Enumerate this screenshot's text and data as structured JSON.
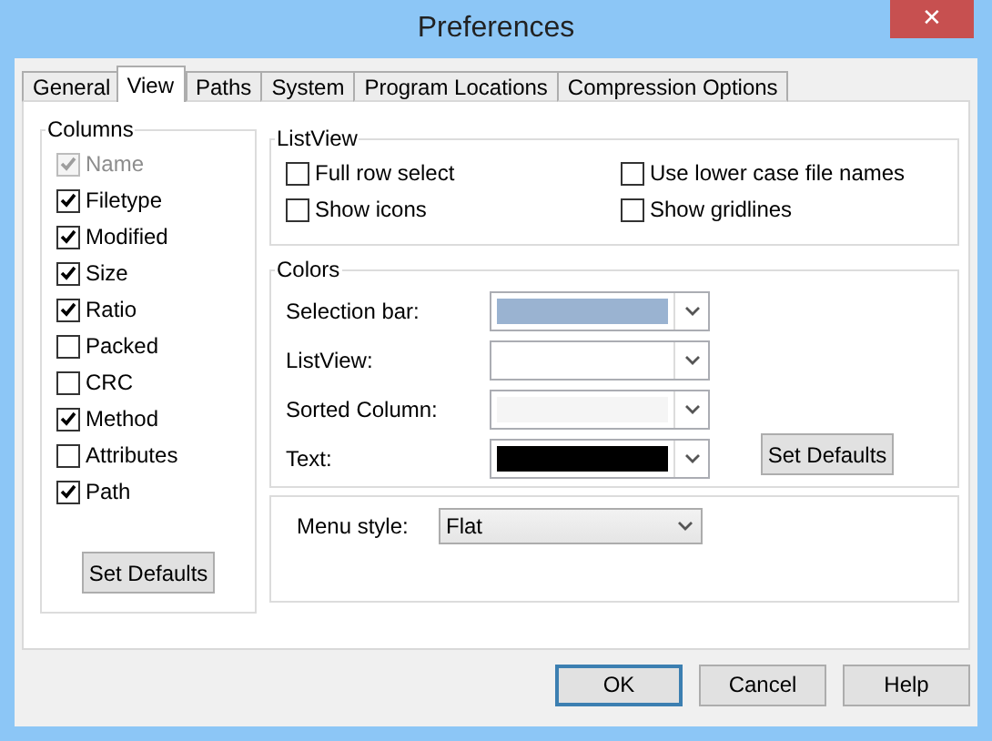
{
  "window": {
    "title": "Preferences",
    "close": "✕"
  },
  "tabs": [
    {
      "label": "General",
      "selected": false
    },
    {
      "label": "View",
      "selected": true
    },
    {
      "label": "Paths",
      "selected": false
    },
    {
      "label": "System",
      "selected": false
    },
    {
      "label": "Program Locations",
      "selected": false
    },
    {
      "label": "Compression Options",
      "selected": false
    }
  ],
  "columns": {
    "title": "Columns",
    "items": [
      {
        "label": "Name",
        "checked": true,
        "disabled": true
      },
      {
        "label": "Filetype",
        "checked": true,
        "disabled": false
      },
      {
        "label": "Modified",
        "checked": true,
        "disabled": false
      },
      {
        "label": "Size",
        "checked": true,
        "disabled": false
      },
      {
        "label": "Ratio",
        "checked": true,
        "disabled": false
      },
      {
        "label": "Packed",
        "checked": false,
        "disabled": false
      },
      {
        "label": "CRC",
        "checked": false,
        "disabled": false
      },
      {
        "label": "Method",
        "checked": true,
        "disabled": false
      },
      {
        "label": "Attributes",
        "checked": false,
        "disabled": false
      },
      {
        "label": "Path",
        "checked": true,
        "disabled": false
      }
    ],
    "button": "Set Defaults"
  },
  "listview": {
    "title": "ListView",
    "options": [
      {
        "label": "Full row select",
        "checked": false
      },
      {
        "label": "Use lower case file names",
        "checked": false
      },
      {
        "label": "Show icons",
        "checked": false
      },
      {
        "label": "Show gridlines",
        "checked": false
      }
    ]
  },
  "colors": {
    "title": "Colors",
    "rows": [
      {
        "label": "Selection bar:",
        "color": "#9ab3d1"
      },
      {
        "label": "ListView:",
        "color": "#ffffff"
      },
      {
        "label": "Sorted Column:",
        "color": "#f5f5f5"
      },
      {
        "label": "Text:",
        "color": "#000000"
      }
    ],
    "button": "Set Defaults"
  },
  "menu_style": {
    "label": "Menu style:",
    "value": "Flat"
  },
  "buttons": [
    {
      "label": "OK",
      "default": true
    },
    {
      "label": "Cancel",
      "default": false
    },
    {
      "label": "Help",
      "default": false
    }
  ]
}
